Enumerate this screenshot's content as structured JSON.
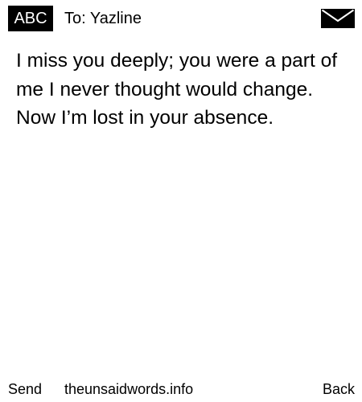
{
  "header": {
    "input_mode": "ABC",
    "recipient": "To: Yazline",
    "status_icon": "envelope-icon"
  },
  "message": {
    "body": "I miss you deeply; you were a part of me I never thought would change. Now I’m lost in your absence."
  },
  "footer": {
    "left_softkey": "Send",
    "site": "theunsaidwords.info",
    "right_softkey": "Back"
  }
}
